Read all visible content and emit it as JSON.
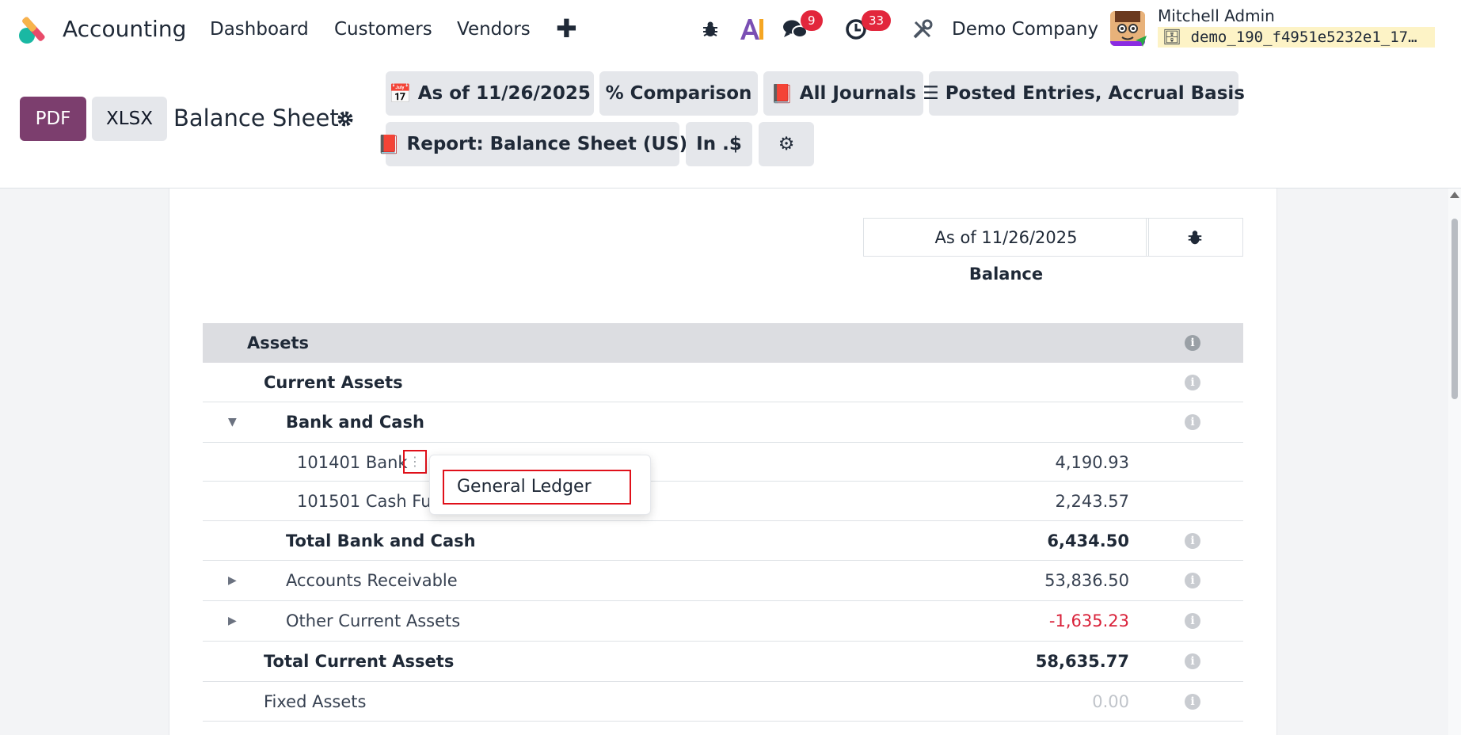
{
  "navbar": {
    "app_title": "Accounting",
    "links": [
      "Dashboard",
      "Customers",
      "Vendors"
    ],
    "messages_badge": "9",
    "activities_badge": "33",
    "company": "Demo Company",
    "user_name": "Mitchell Admin",
    "database": "demo_190_f4951e5232e1_17…",
    "icons": [
      "plus-icon",
      "bug-icon",
      "ai-icon",
      "chat-icon",
      "clock-icon",
      "tools-icon",
      "database-icon"
    ]
  },
  "control": {
    "pdf_label": "PDF",
    "xlsx_label": "XLSX",
    "title": "Balance Sheet",
    "filters": {
      "date": "As of 11/26/2025",
      "comparison": "Comparison",
      "journals": "All Journals",
      "entries": "Posted Entries, Accrual Basis",
      "report": "Report: Balance Sheet (US)",
      "currency": "In .$"
    }
  },
  "report": {
    "column_header": "As of 11/26/2025",
    "column_sub": "Balance",
    "rows": [
      {
        "label": "Assets",
        "value": ""
      },
      {
        "label": "Current Assets",
        "value": ""
      },
      {
        "label": "Bank and Cash",
        "value": ""
      },
      {
        "label": "101401 Bank",
        "value": "4,190.93"
      },
      {
        "label": "101501 Cash Fur",
        "value": "2,243.57"
      },
      {
        "label": "Total Bank and Cash",
        "value": "6,434.50"
      },
      {
        "label": "Accounts Receivable",
        "value": "53,836.50"
      },
      {
        "label": "Other Current Assets",
        "value": "-1,635.23"
      },
      {
        "label": "Total Current Assets",
        "value": "58,635.77"
      },
      {
        "label": "Fixed Assets",
        "value": "0.00"
      }
    ],
    "popup_item": "General Ledger"
  },
  "colors": {
    "brand": "#7c3e6e",
    "badge": "#e2263c",
    "negative": "#d9223a",
    "highlight": "#e0101a"
  }
}
